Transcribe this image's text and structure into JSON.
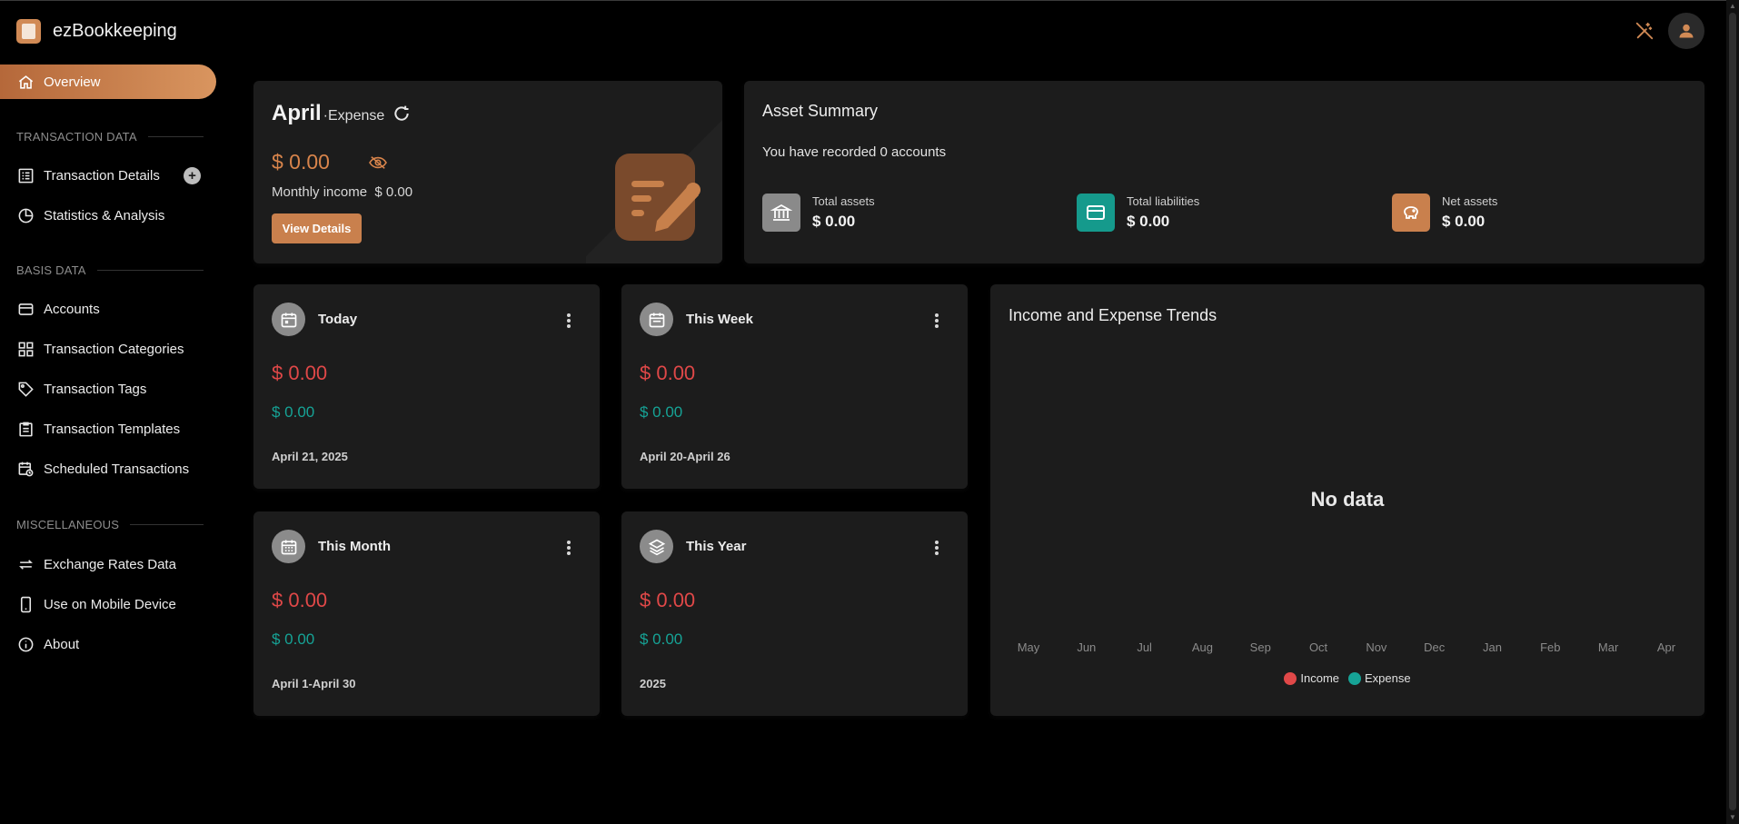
{
  "app": {
    "name": "ezBookkeeping"
  },
  "colors": {
    "accent": "#d18a55",
    "expense": "#e04848",
    "income": "#16a396",
    "background": "#000000",
    "card": "#1c1c1c"
  },
  "sidebar": {
    "overview": "Overview",
    "sections": {
      "transaction_data": "TRANSACTION DATA",
      "basis_data": "BASIS DATA",
      "miscellaneous": "MISCELLANEOUS"
    },
    "items": {
      "transaction_details": "Transaction Details",
      "statistics": "Statistics & Analysis",
      "accounts": "Accounts",
      "categories": "Transaction Categories",
      "tags": "Transaction Tags",
      "templates": "Transaction Templates",
      "scheduled": "Scheduled Transactions",
      "exchange_rates": "Exchange Rates Data",
      "mobile": "Use on Mobile Device",
      "about": "About"
    }
  },
  "expense_card": {
    "month": "April",
    "suffix": "·Expense",
    "amount": "$ 0.00",
    "monthly_income_label": "Monthly income",
    "monthly_income_value": "$ 0.00",
    "view_details": "View Details"
  },
  "asset_summary": {
    "title": "Asset Summary",
    "subtitle": "You have recorded 0 accounts",
    "total_assets_label": "Total assets",
    "total_assets_value": "$ 0.00",
    "total_liabilities_label": "Total liabilities",
    "total_liabilities_value": "$ 0.00",
    "net_assets_label": "Net assets",
    "net_assets_value": "$ 0.00"
  },
  "periods": {
    "today": {
      "name": "Today",
      "expense": "$ 0.00",
      "income": "$ 0.00",
      "date": "April 21, 2025"
    },
    "week": {
      "name": "This Week",
      "expense": "$ 0.00",
      "income": "$ 0.00",
      "date": "April 20-April 26"
    },
    "month": {
      "name": "This Month",
      "expense": "$ 0.00",
      "income": "$ 0.00",
      "date": "April 1-April 30"
    },
    "year": {
      "name": "This Year",
      "expense": "$ 0.00",
      "income": "$ 0.00",
      "date": "2025"
    }
  },
  "trends": {
    "title": "Income and Expense Trends",
    "empty": "No data",
    "months": [
      "May",
      "Jun",
      "Jul",
      "Aug",
      "Sep",
      "Oct",
      "Nov",
      "Dec",
      "Jan",
      "Feb",
      "Mar",
      "Apr"
    ],
    "legend_income": "Income",
    "legend_expense": "Expense"
  }
}
